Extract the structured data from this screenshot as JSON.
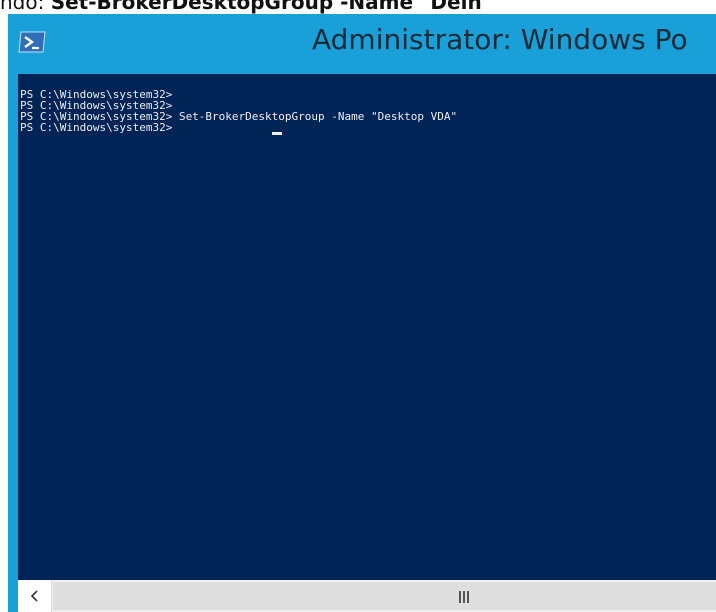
{
  "caption": {
    "prefix": "ndo: ",
    "command": "Set-BrokerDesktopGroup -Name \"Delh"
  },
  "window": {
    "title": "Administrator: Windows Po",
    "icon": "powershell-icon",
    "colors": {
      "frame": "#19a0d8",
      "console_bg": "#012456",
      "console_text": "#eeedf0"
    }
  },
  "console": {
    "lines": [
      "PS C:\\Windows\\system32>",
      "PS C:\\Windows\\system32>",
      "PS C:\\Windows\\system32> Set-BrokerDesktopGroup -Name \"Desktop VDA\"",
      "PS C:\\Windows\\system32> "
    ]
  },
  "scrollbar": {
    "left_arrow": "chevron-left-icon",
    "grip": "grip-icon"
  }
}
